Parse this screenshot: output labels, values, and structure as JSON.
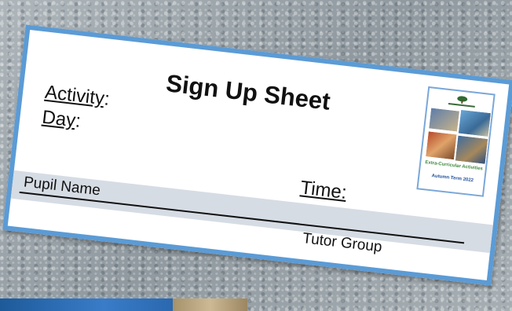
{
  "sheet": {
    "title": "Sign Up Sheet",
    "activity_label": "Activity",
    "activity_colon": ":",
    "day_label": "Day",
    "day_colon": ":",
    "time_label": "Time:"
  },
  "table": {
    "columns": [
      "Pupil Name",
      "Tutor Group"
    ]
  },
  "brochure": {
    "heading": "Extra-Curricular Activities",
    "term": "Autumn Term 2022"
  },
  "colors": {
    "card_border": "#5b9bd5",
    "table_header_bg": "#d6dce4",
    "brochure_heading": "#3c8a3c",
    "brochure_term": "#1f4e9a"
  }
}
